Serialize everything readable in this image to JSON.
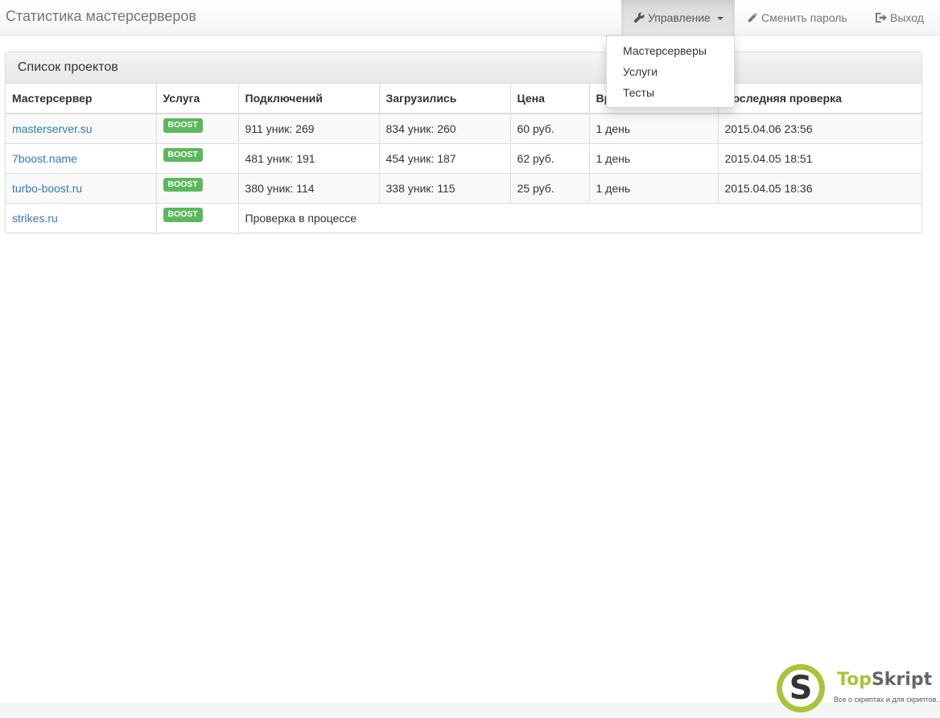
{
  "brand": "Статистика мастерсерверов",
  "nav": {
    "manage_label": "Управление",
    "change_password_label": "Сменить пароль",
    "logout_label": "Выход"
  },
  "dropdown": {
    "items": [
      "Мастерсерверы",
      "Услуги",
      "Тесты"
    ]
  },
  "panel": {
    "title": "Список проектов"
  },
  "table": {
    "headers": [
      "Мастерсервер",
      "Услуга",
      "Подключений",
      "Загрузились",
      "Цена",
      "Время",
      "Последняя проверка"
    ],
    "rows": [
      {
        "server": "masterserver.su",
        "badge": "BOOST",
        "connections": "911 уник: 269",
        "loaded": "834 уник: 260",
        "price": "60 руб.",
        "time": "1 день",
        "last_check": "2015.04.06 23:56"
      },
      {
        "server": "7boost.name",
        "badge": "BOOST",
        "connections": "481 уник: 191",
        "loaded": "454 уник: 187",
        "price": "62 руб.",
        "time": "1 день",
        "last_check": "2015.04.05 18:51"
      },
      {
        "server": "turbo-boost.ru",
        "badge": "BOOST",
        "connections": "380 уник: 114",
        "loaded": "338 уник: 115",
        "price": "25 руб.",
        "time": "1 день",
        "last_check": "2015.04.05 18:36"
      }
    ],
    "pending_row": {
      "server": "strikes.ru",
      "badge": "BOOST",
      "status": "Проверка в процессе"
    }
  },
  "watermark": {
    "letter": "S",
    "title_a": "Top",
    "title_b": "Skript",
    "subtitle": "Все о скриптах и для скриптов..."
  },
  "colors": {
    "link": "#337ab7",
    "badge": "#5cb85c",
    "watermark_green": "#a8c43a"
  },
  "icons": {
    "manage": "wrench-icon",
    "change_password": "pencil-icon",
    "logout": "logout-icon"
  }
}
